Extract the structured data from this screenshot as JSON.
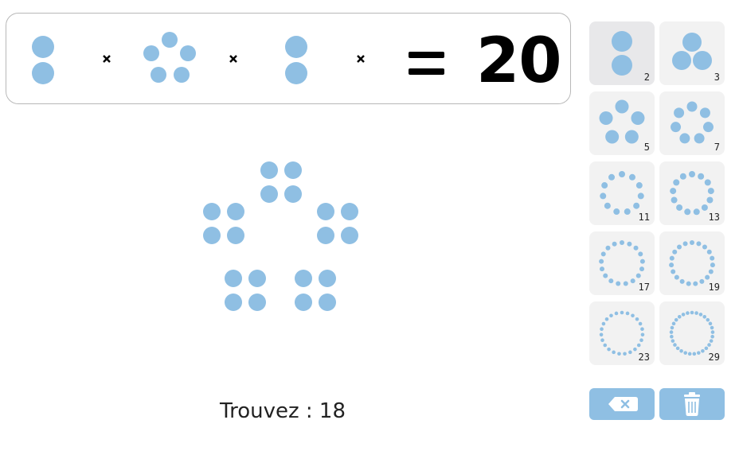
{
  "equation": {
    "factors": [
      2,
      5,
      2
    ],
    "operator_icon": "times-icon",
    "equals": "=",
    "result": "20"
  },
  "board": {
    "groups": 5,
    "dots_per_group": 4
  },
  "prompt": "Trouvez : 18",
  "palette": {
    "selected": 2,
    "items": [
      {
        "label": "2",
        "n": 2
      },
      {
        "label": "3",
        "n": 3
      },
      {
        "label": "5",
        "n": 5
      },
      {
        "label": "7",
        "n": 7
      },
      {
        "label": "11",
        "n": 11
      },
      {
        "label": "13",
        "n": 13
      },
      {
        "label": "17",
        "n": 17
      },
      {
        "label": "19",
        "n": 19
      },
      {
        "label": "23",
        "n": 23
      },
      {
        "label": "29",
        "n": 29
      }
    ]
  },
  "tools": {
    "backspace_icon": "backspace-icon",
    "trash_icon": "trash-icon"
  },
  "colors": {
    "dot": "#8fbfe3",
    "tile": "#f2f2f2",
    "tile_active": "#e8e8ea",
    "tool": "#8fbfe3"
  }
}
